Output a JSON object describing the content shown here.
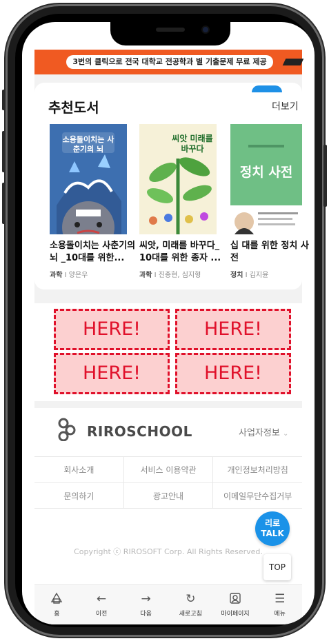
{
  "banner": {
    "text": "3번의 클릭으로 전국 대학교 전공학과 별 기출문제 무료 제공"
  },
  "recommend": {
    "title": "추천도서",
    "more_label": "더보기",
    "books": [
      {
        "title": "소용돌이치는 사춘기의 뇌 _10대를 위한...",
        "category": "과학",
        "author": "양은우",
        "cover_text": "소용돌이치는 사춘기의 뇌"
      },
      {
        "title": "씨앗, 미래를 바꾸다_ 10대를 위한 종자 ...",
        "category": "과학",
        "author": "진종현, 심지형",
        "cover_text": "씨앗 미래를 바꾸다"
      },
      {
        "title": "십 대를 위한 정치 사전",
        "category": "정치",
        "author": "김지윤",
        "cover_text": "정치 사전"
      }
    ]
  },
  "ads": {
    "slots": [
      "HERE!",
      "HERE!",
      "HERE!",
      "HERE!"
    ]
  },
  "footer": {
    "logo_text": "RIROSCHOOL",
    "biz_info_label": "사업자정보",
    "links_row1": [
      "회사소개",
      "서비스 이용약관",
      "개인정보처리방침"
    ],
    "links_row2": [
      "문의하기",
      "광고안내",
      "이메일무단수집거부"
    ],
    "copyright": "Copyright ⓒ RIROSOFT Corp. All Rights Reserved.",
    "talk_line1": "리로",
    "talk_line2": "TALK",
    "top_label": "TOP"
  },
  "nav": [
    {
      "label": "홈",
      "icon": "home-icon"
    },
    {
      "label": "이전",
      "icon": "arrow-left-icon"
    },
    {
      "label": "다음",
      "icon": "arrow-right-icon"
    },
    {
      "label": "새로고침",
      "icon": "refresh-icon"
    },
    {
      "label": "마이페이지",
      "icon": "mypage-icon"
    },
    {
      "label": "메뉴",
      "icon": "menu-icon"
    }
  ],
  "colors": {
    "banner": "#f05a22",
    "accent": "#1a92e8",
    "ad_border": "#e0102a",
    "ad_fill": "#fcd0d0"
  }
}
